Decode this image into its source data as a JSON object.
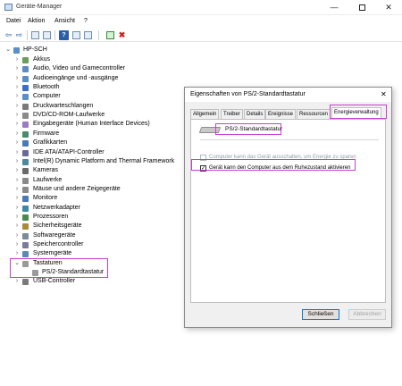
{
  "window": {
    "title": "Geräte-Manager",
    "minimize_glyph": "—",
    "close_glyph": "✕"
  },
  "menu": {
    "items": [
      "Datei",
      "Aktion",
      "Ansicht",
      "?"
    ]
  },
  "toolbar": {
    "back_glyph": "⇦",
    "forward_glyph": "⇨",
    "help_glyph": "?",
    "remove_glyph": "✖"
  },
  "tree": {
    "root": "HP-SCH",
    "categories": [
      {
        "label": "Akkus",
        "icon": "battery-icon"
      },
      {
        "label": "Audio, Video und Gamecontroller",
        "icon": "speaker-icon"
      },
      {
        "label": "Audioeingänge und -ausgänge",
        "icon": "speaker-icon"
      },
      {
        "label": "Bluetooth",
        "icon": "bluetooth-icon"
      },
      {
        "label": "Computer",
        "icon": "computer-icon"
      },
      {
        "label": "Druckwarteschlangen",
        "icon": "printer-icon"
      },
      {
        "label": "DVD/CD-ROM-Laufwerke",
        "icon": "disc-icon"
      },
      {
        "label": "Eingabegeräte (Human Interface Devices)",
        "icon": "hid-icon"
      },
      {
        "label": "Firmware",
        "icon": "chip-icon"
      },
      {
        "label": "Grafikkarten",
        "icon": "display-adapter-icon"
      },
      {
        "label": "IDE ATA/ATAPI-Controller",
        "icon": "controller-icon"
      },
      {
        "label": "Intel(R) Dynamic Platform and Thermal Framework",
        "icon": "chip-icon"
      },
      {
        "label": "Kameras",
        "icon": "camera-icon"
      },
      {
        "label": "Laufwerke",
        "icon": "drive-icon"
      },
      {
        "label": "Mäuse und andere Zeigegeräte",
        "icon": "mouse-icon"
      },
      {
        "label": "Monitore",
        "icon": "monitor-icon"
      },
      {
        "label": "Netzwerkadapter",
        "icon": "network-icon"
      },
      {
        "label": "Prozessoren",
        "icon": "cpu-icon"
      },
      {
        "label": "Sicherheitsgeräte",
        "icon": "security-icon"
      },
      {
        "label": "Softwaregeräte",
        "icon": "software-icon"
      },
      {
        "label": "Speichercontroller",
        "icon": "storage-icon"
      },
      {
        "label": "Systemgeräte",
        "icon": "system-icon"
      },
      {
        "label": "Tastaturen",
        "icon": "keyboard-icon"
      },
      {
        "label": "PS/2-Standardtastatur",
        "icon": "keyboard-icon"
      },
      {
        "label": "USB-Controller",
        "icon": "usb-icon"
      }
    ],
    "expanded_glyph": "⌄",
    "collapsed_glyph": "›"
  },
  "dialog": {
    "title": "Eigenschaften von PS/2-Standardtastatur",
    "close_glyph": "✕",
    "tabs": [
      "Allgemein",
      "Treiber",
      "Details",
      "Ereignisse",
      "Ressourcen",
      "Energieverwaltung"
    ],
    "active_tab": "Energieverwaltung",
    "device_name": "PS/2-Standardtastatur",
    "option_power_off": {
      "label": "Computer kann das Gerät ausschalten, um Energie zu sparen",
      "checked": false,
      "enabled": false
    },
    "option_wake": {
      "label": "Gerät kann den Computer aus dem Ruhezustand aktivieren",
      "checked": true,
      "enabled": true
    },
    "check_glyph": "✓",
    "close_button": "Schließen",
    "cancel_button": "Abbrechen"
  },
  "colors": {
    "highlight": "#c640d0",
    "accent": "#0078d7"
  }
}
